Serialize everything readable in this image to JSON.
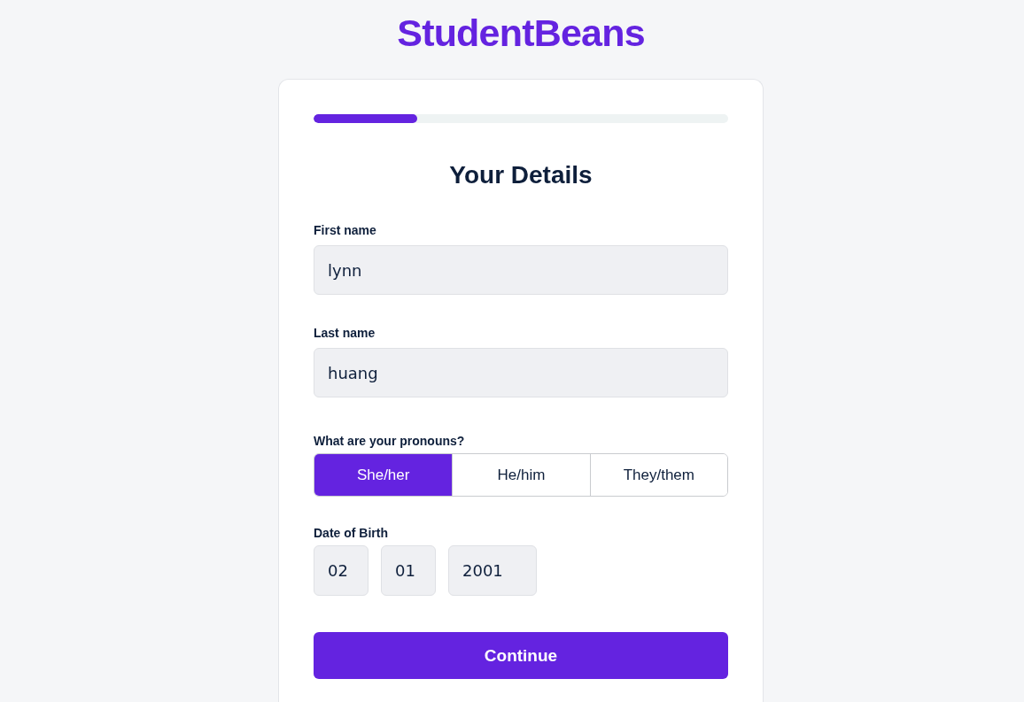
{
  "logo": "StudentBeans",
  "progress": {
    "level": 0.25
  },
  "title": "Your Details",
  "fields": [
    {
      "label": "First name",
      "value": "lynn"
    },
    {
      "label": "Last name",
      "value": "huang"
    }
  ],
  "pronouns": {
    "label": "What are your pronouns?",
    "options": [
      {
        "label": "She/her",
        "selected": true
      },
      {
        "label": "He/him",
        "selected": false
      },
      {
        "label": "They/them",
        "selected": false
      }
    ]
  },
  "date_of_birth": {
    "label": "Date of Birth",
    "parts": [
      "02",
      "01",
      "2001"
    ]
  },
  "buttons": [
    {
      "label": "Continue"
    }
  ]
}
